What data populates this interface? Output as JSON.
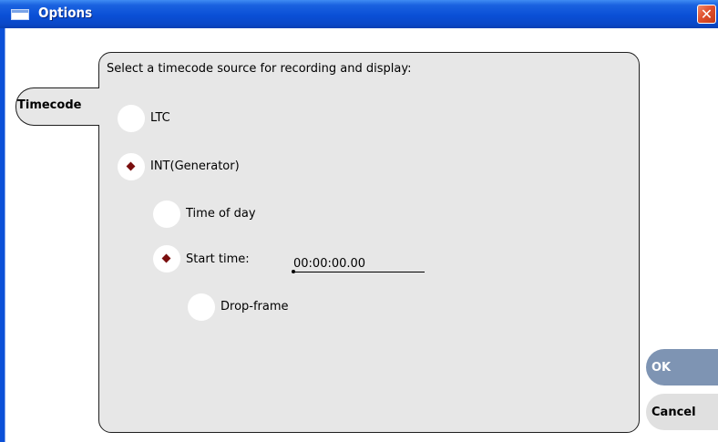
{
  "window": {
    "title": "Options",
    "close_glyph": "✕",
    "title_icon": "window-icon"
  },
  "tabs": [
    {
      "label": "Timecode",
      "selected": true
    }
  ],
  "timecode": {
    "prompt": "Select a timecode source for recording and display:",
    "sources": [
      {
        "label": "LTC",
        "selected": false
      },
      {
        "label": "INT(Generator)",
        "selected": true
      }
    ],
    "generator": {
      "options": [
        {
          "label": "Time of day",
          "selected": false
        },
        {
          "label": "Start time:",
          "selected": true
        }
      ],
      "start_time_value": "00:00:00.00",
      "drop_frame_label": "Drop-frame",
      "drop_frame_checked": false
    }
  },
  "buttons": {
    "ok": "OK",
    "cancel": "Cancel"
  },
  "colors": {
    "titlebar": "#0a4fd6",
    "panel": "#e7e7e7",
    "selected_marker": "#7a0e0e",
    "ok_button": "#7e94b3",
    "close_button": "#e0502e"
  }
}
